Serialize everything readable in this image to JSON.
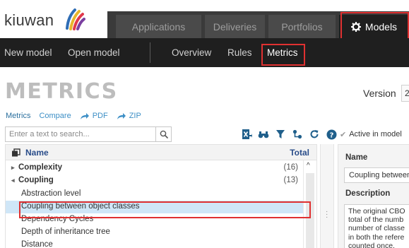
{
  "app": {
    "brand": "kiuwan"
  },
  "top_tabs": [
    {
      "label": "Applications",
      "active": false
    },
    {
      "label": "Deliveries",
      "active": false
    },
    {
      "label": "Portfolios",
      "active": false
    },
    {
      "label": "Models",
      "active": true,
      "icon": "gear-icon"
    }
  ],
  "subnav": {
    "items": [
      {
        "label": "New model",
        "active": false
      },
      {
        "label": "Open model",
        "active": false
      },
      {
        "label": "Overview",
        "active": false
      },
      {
        "label": "Rules",
        "active": false
      },
      {
        "label": "Metrics",
        "active": true
      }
    ]
  },
  "page": {
    "title": "METRICS",
    "version_label": "Version",
    "version_value": "2"
  },
  "breadcrumbs": [
    {
      "label": "Metrics",
      "current": true
    },
    {
      "label": "Compare",
      "current": false
    },
    {
      "label": "PDF",
      "current": false,
      "icon": "share-arrow-icon"
    },
    {
      "label": "ZIP",
      "current": false,
      "icon": "share-arrow-icon"
    }
  ],
  "search": {
    "placeholder": "Enter a text to search...",
    "value": ""
  },
  "toolbar_icons": [
    "export-excel-icon",
    "binoculars-icon",
    "filter-icon",
    "hierarchy-icon",
    "refresh-icon",
    "help-icon"
  ],
  "table": {
    "columns": {
      "name": "Name",
      "total": "Total"
    },
    "rows": [
      {
        "label": "Complexity",
        "total": "(16)",
        "type": "group",
        "expanded": false
      },
      {
        "label": "Coupling",
        "total": "(13)",
        "type": "group",
        "expanded": true
      },
      {
        "label": "Abstraction level",
        "total": "",
        "type": "item"
      },
      {
        "label": "Coupling between object classes",
        "total": "",
        "type": "item",
        "selected": true
      },
      {
        "label": "Dependency Cycles",
        "total": "",
        "type": "item"
      },
      {
        "label": "Depth of inheritance tree",
        "total": "",
        "type": "item"
      },
      {
        "label": "Distance",
        "total": "",
        "type": "item"
      }
    ]
  },
  "detail": {
    "active_label": "Active in model",
    "name_label": "Name",
    "name_value": "Coupling between object classes",
    "description_label": "Description",
    "description_lines": [
      "The original CBO",
      "total of the numb",
      "number of classe",
      "in both the refere",
      "counted once."
    ]
  },
  "colors": {
    "accent_red": "#e03131",
    "link_blue": "#3d8fc6",
    "header_dark": "#1f1f1f",
    "selection": "#cfe6f7"
  }
}
